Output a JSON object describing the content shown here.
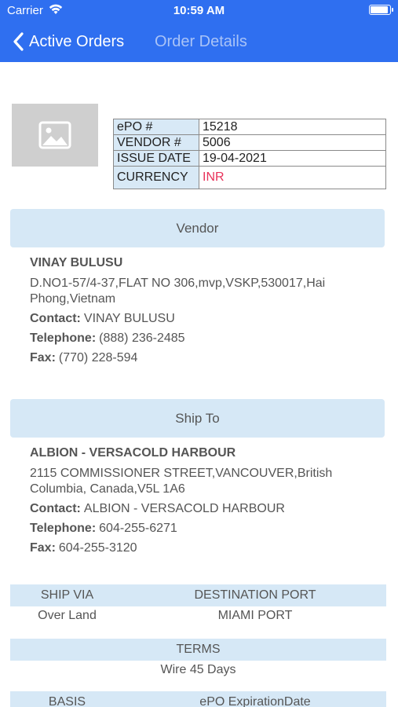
{
  "status": {
    "carrier": "Carrier",
    "time": "10:59 AM"
  },
  "nav": {
    "back_label": "Active Orders",
    "title": "Order Details"
  },
  "order": {
    "rows": [
      {
        "key": "ePO #",
        "value": "15218"
      },
      {
        "key": "VENDOR #",
        "value": "5006"
      },
      {
        "key": "ISSUE DATE",
        "value": "19-04-2021"
      },
      {
        "key": "CURRENCY",
        "value": "INR"
      }
    ],
    "currency_color": "#e8325a"
  },
  "vendor": {
    "header": "Vendor",
    "name": "VINAY BULUSU",
    "address": "D.NO1-57/4-37,FLAT NO 306,mvp,VSKP,530017,Hai Phong,Vietnam",
    "contact_label": "Contact:",
    "contact": "VINAY BULUSU",
    "telephone_label": "Telephone:",
    "telephone": "(888) 236-2485",
    "fax_label": "Fax:",
    "fax": "(770) 228-594"
  },
  "ship_to": {
    "header": "Ship To",
    "name": "ALBION - VERSACOLD HARBOUR",
    "address": "2115 COMMISSIONER STREET,VANCOUVER,British Columbia, Canada,V5L 1A6",
    "contact_label": "Contact:",
    "contact": "ALBION - VERSACOLD HARBOUR",
    "telephone_label": "Telephone:",
    "telephone": "604-255-6271",
    "fax_label": "Fax:",
    "fax": "604-255-3120"
  },
  "details": {
    "ship_via_label": "SHIP VIA",
    "ship_via": "Over Land",
    "destination_port_label": "DESTINATION PORT",
    "destination_port": "MIAMI PORT",
    "terms_label": "TERMS",
    "terms": "Wire 45 Days",
    "basis_label": "BASIS",
    "expiration_label": "ePO ExpirationDate"
  },
  "colors": {
    "nav_bar": "#2f6ff0",
    "section_bg": "#d6e8f6",
    "key_cell_bg": "#d8e9f6"
  },
  "icons": {
    "back": "chevron-left-icon",
    "thumbnail": "image-placeholder-icon",
    "wifi": "wifi-icon",
    "battery": "battery-icon"
  }
}
